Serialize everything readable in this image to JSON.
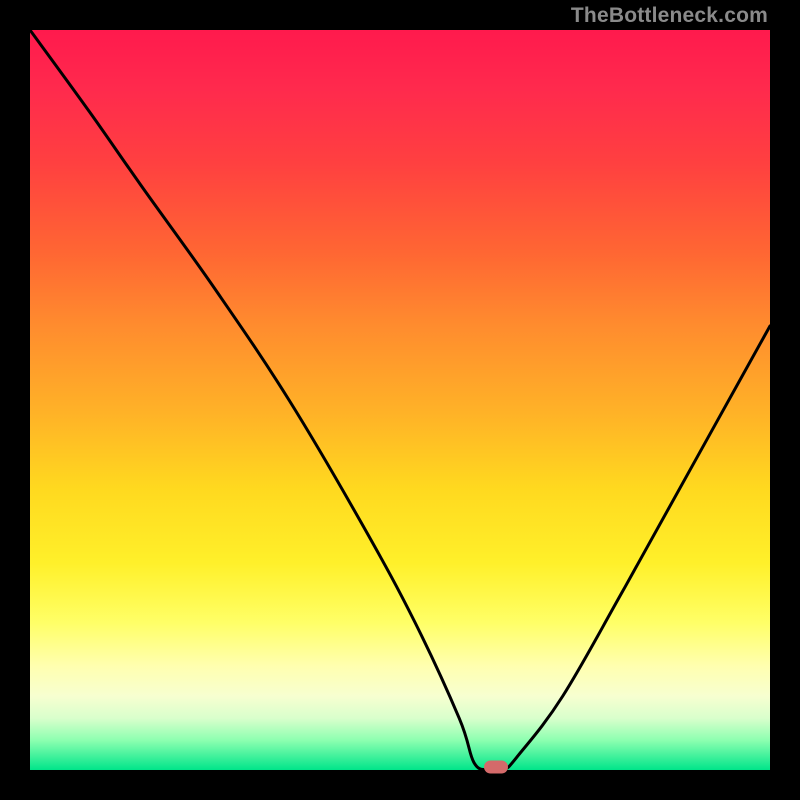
{
  "watermark": "TheBottleneck.com",
  "chart_data": {
    "type": "line",
    "title": "",
    "xlabel": "",
    "ylabel": "",
    "xlim": [
      0,
      100
    ],
    "ylim": [
      0,
      100
    ],
    "x": [
      0,
      8,
      15,
      25,
      35,
      45,
      52,
      58,
      60,
      62,
      64,
      66,
      72,
      80,
      90,
      100
    ],
    "values": [
      100,
      89,
      79,
      65,
      50,
      33,
      20,
      7,
      1,
      0,
      0,
      2,
      10,
      24,
      42,
      60
    ],
    "marker": {
      "x": 63,
      "y": 0,
      "color": "#d46a6a"
    },
    "note": "values estimated visually from the rendered curve"
  },
  "colors": {
    "frame": "#000000",
    "gradient_top": "#ff1a4d",
    "gradient_bottom": "#00e58a",
    "curve": "#000000",
    "marker": "#d46a6a",
    "watermark": "#8a8a8a"
  }
}
